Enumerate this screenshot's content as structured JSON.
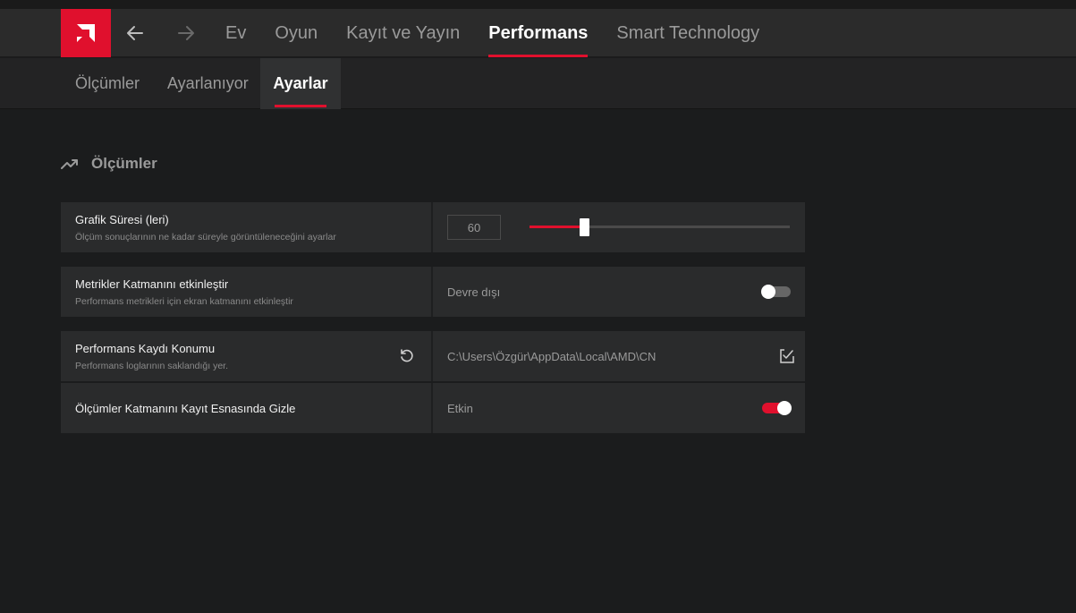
{
  "app": {
    "logo_icon": "amd-logo-icon",
    "brand_color": "#e0102d"
  },
  "nav": {
    "back_icon": "arrow-left-icon",
    "forward_icon": "arrow-right-icon",
    "tabs": [
      {
        "label": "Ev"
      },
      {
        "label": "Oyun"
      },
      {
        "label": "Kayıt ve Yayın"
      },
      {
        "label": "Performans",
        "active": true
      },
      {
        "label": "Smart Technology"
      }
    ]
  },
  "subnav": {
    "tabs": [
      {
        "label": "Ölçümler"
      },
      {
        "label": "Ayarlanıyor"
      },
      {
        "label": "Ayarlar",
        "active": true
      }
    ]
  },
  "section": {
    "icon": "trend-up-icon",
    "title": "Ölçümler"
  },
  "settings": {
    "graph_duration": {
      "title": "Grafik Süresi (leri)",
      "description": "Ölçüm sonuçlarının ne kadar süreyle görüntüleneceğini ayarlar",
      "value": "60",
      "slider_fraction": 0.21
    },
    "metrics_overlay": {
      "title": "Metrikler Katmanını etkinleştir",
      "description": "Performans metrikleri için ekran katmanını etkinleştir",
      "state_label": "Devre dışı",
      "enabled": false
    },
    "log_location": {
      "title": "Performans Kaydı Konumu",
      "description": "Performans loglarının saklandığı yer.",
      "path": "C:\\Users\\Özgür\\AppData\\Local\\AMD\\CN",
      "reset_icon": "reset-icon",
      "browse_icon": "folder-browse-icon"
    },
    "hide_overlay_recording": {
      "title": "Ölçümler Katmanını Kayıt Esnasında Gizle",
      "state_label": "Etkin",
      "enabled": true
    }
  }
}
